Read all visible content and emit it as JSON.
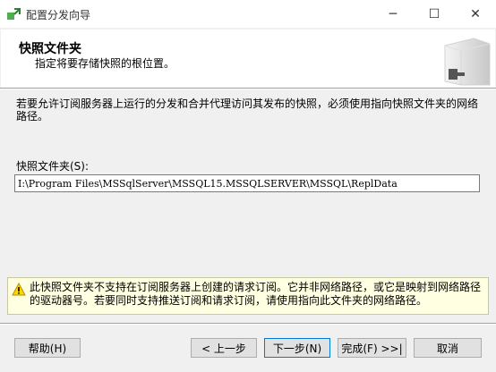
{
  "window": {
    "title": "配置分发向导",
    "minimize_glyph": "─",
    "maximize_glyph": "☐",
    "close_glyph": "✕"
  },
  "header": {
    "title": "快照文件夹",
    "subtitle": "指定将要存储快照的根位置。"
  },
  "main": {
    "description": "若要允许订阅服务器上运行的分发和合并代理访问其发布的快照，必须使用指向快照文件夹的网络路径。",
    "folder_label": "快照文件夹(S):",
    "folder_value": "I:\\Program Files\\MSSqlServer\\MSSQL15.MSSQLSERVER\\MSSQL\\ReplData"
  },
  "warning": {
    "icon": "warning-icon",
    "text": "此快照文件夹不支持在订阅服务器上创建的请求订阅。它并非网络路径，或它是映射到网络路径的驱动器号。若要同时支持推送订阅和请求订阅，请使用指向此文件夹的网络路径。"
  },
  "buttons": {
    "help": "帮助(H)",
    "back": "< 上一步",
    "next": "下一步(N)",
    "finish": "完成(F) >>|",
    "cancel": "取消"
  },
  "colors": {
    "dialog_bg": "#f0f0f0",
    "header_bg": "#ffffff",
    "warning_bg": "#ffffe1",
    "default_button_border": "#0078d7"
  }
}
